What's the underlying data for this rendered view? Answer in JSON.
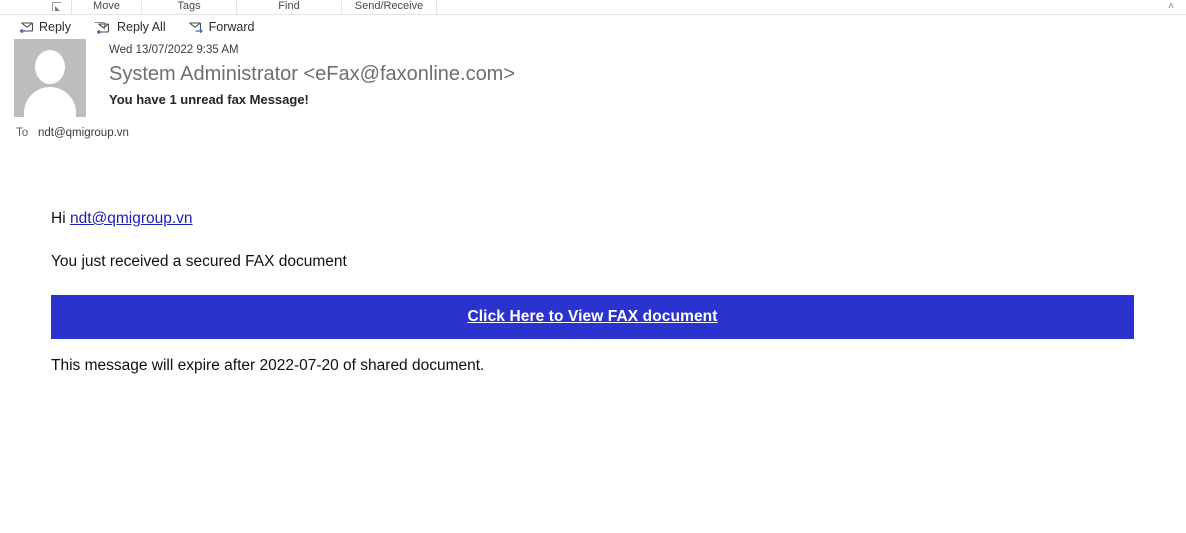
{
  "ribbon": {
    "launcher_icon": "dialog-launcher-icon",
    "groups": [
      {
        "label": "Move"
      },
      {
        "label": "Tags"
      },
      {
        "label": "Find"
      },
      {
        "label": "Send/Receive"
      }
    ],
    "collapse_icon": "˄",
    "collapse_title": "Collapse the Ribbon"
  },
  "toolbar": {
    "reply_label": "Reply",
    "reply_all_label": "Reply All",
    "forward_label": "Forward"
  },
  "message": {
    "date": "Wed 13/07/2022 9:35 AM",
    "from": "System Administrator <eFax@faxonline.com>",
    "subject": "You have 1 unread fax Message!",
    "to_label": "To",
    "to_value": "ndt@qmigroup.vn"
  },
  "body": {
    "greeting_prefix": "Hi ",
    "greeting_link": "ndt@qmigroup.vn",
    "line_received": "You just received a secured FAX document",
    "cta_label": "Click Here to View FAX document",
    "line_expire": "This message will expire after 2022-07-20 of shared document."
  },
  "colors": {
    "cta_background": "#2b33ce",
    "link": "#1d1dbb",
    "from_text": "#6f6f6f",
    "avatar_background": "#bdbdbd"
  }
}
